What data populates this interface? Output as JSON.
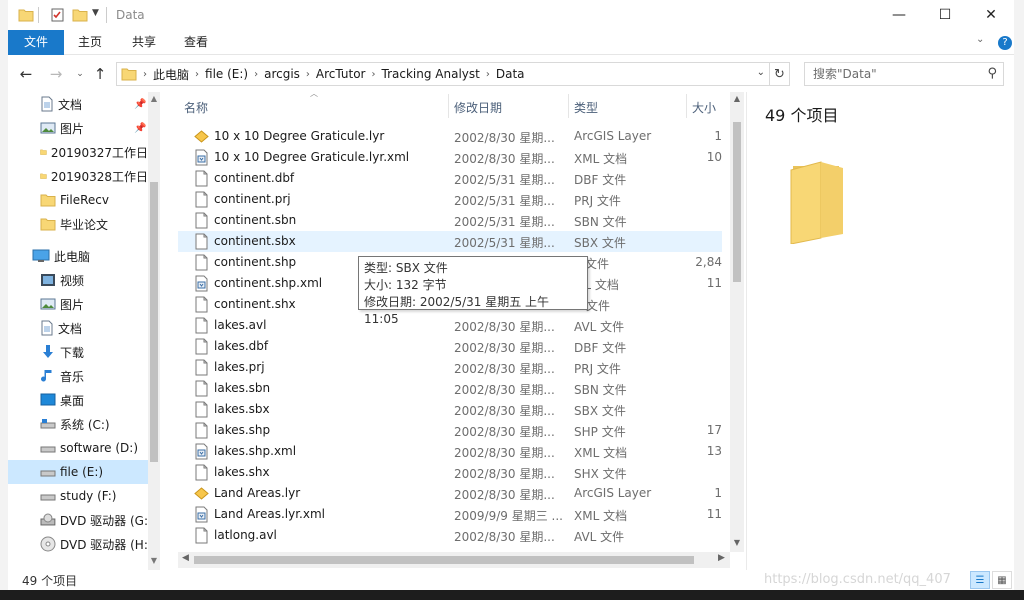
{
  "window": {
    "title": "Data"
  },
  "ribbon": {
    "tabs": [
      "文件",
      "主页",
      "共享",
      "查看"
    ]
  },
  "address": {
    "segments": [
      "此电脑",
      "file (E:)",
      "arcgis",
      "ArcTutor",
      "Tracking Analyst",
      "Data"
    ]
  },
  "search": {
    "placeholder": "搜索\"Data\""
  },
  "sidebar": {
    "items": [
      {
        "label": "文档",
        "icon": "document-icon",
        "pinned": true
      },
      {
        "label": "图片",
        "icon": "pictures-icon",
        "pinned": true
      },
      {
        "label": "20190327工作日",
        "icon": "folder-icon"
      },
      {
        "label": "20190328工作日",
        "icon": "folder-icon"
      },
      {
        "label": "FileRecv",
        "icon": "folder-icon"
      },
      {
        "label": "毕业论文",
        "icon": "folder-icon"
      },
      {
        "label": "此电脑",
        "icon": "computer-icon"
      },
      {
        "label": "视频",
        "icon": "video-icon"
      },
      {
        "label": "图片",
        "icon": "pictures-icon"
      },
      {
        "label": "文档",
        "icon": "document-icon"
      },
      {
        "label": "下载",
        "icon": "download-icon"
      },
      {
        "label": "音乐",
        "icon": "music-icon"
      },
      {
        "label": "桌面",
        "icon": "desktop-icon"
      },
      {
        "label": "系统 (C:)",
        "icon": "drive-icon"
      },
      {
        "label": "software (D:)",
        "icon": "drive-icon"
      },
      {
        "label": "file (E:)",
        "icon": "drive-icon",
        "selected": true
      },
      {
        "label": "study (F:)",
        "icon": "drive-icon"
      },
      {
        "label": "DVD 驱动器 (G:",
        "icon": "dvd-icon"
      },
      {
        "label": "DVD 驱动器 (H:",
        "icon": "dvd-icon"
      }
    ]
  },
  "columns": {
    "name": "名称",
    "date": "修改日期",
    "type": "类型",
    "size": "大小"
  },
  "files": [
    {
      "name": "10 x 10 Degree Graticule.lyr",
      "date": "2002/8/30 星期...",
      "type": "ArcGIS Layer",
      "size": "1",
      "icon": "layer-icon"
    },
    {
      "name": "10 x 10 Degree Graticule.lyr.xml",
      "date": "2002/8/30 星期...",
      "type": "XML 文档",
      "size": "10",
      "icon": "xml-icon"
    },
    {
      "name": "continent.dbf",
      "date": "2002/5/31 星期...",
      "type": "DBF 文件",
      "size": "",
      "icon": "file-icon"
    },
    {
      "name": "continent.prj",
      "date": "2002/5/31 星期...",
      "type": "PRJ 文件",
      "size": "",
      "icon": "file-icon"
    },
    {
      "name": "continent.sbn",
      "date": "2002/5/31 星期...",
      "type": "SBN 文件",
      "size": "",
      "icon": "file-icon"
    },
    {
      "name": "continent.sbx",
      "date": "2002/5/31 星期...",
      "type": "SBX 文件",
      "size": "",
      "icon": "file-icon",
      "selected": true
    },
    {
      "name": "continent.shp",
      "date": "",
      "type": "P 文件",
      "size": "2,84",
      "icon": "file-icon"
    },
    {
      "name": "continent.shp.xml",
      "date": "",
      "type": "ML 文档",
      "size": "11",
      "icon": "xml-icon"
    },
    {
      "name": "continent.shx",
      "date": "",
      "type": "X 文件",
      "size": "",
      "icon": "file-icon"
    },
    {
      "name": "lakes.avl",
      "date": "2002/8/30 星期...",
      "type": "AVL 文件",
      "size": "",
      "icon": "file-icon"
    },
    {
      "name": "lakes.dbf",
      "date": "2002/8/30 星期...",
      "type": "DBF 文件",
      "size": "",
      "icon": "file-icon"
    },
    {
      "name": "lakes.prj",
      "date": "2002/8/30 星期...",
      "type": "PRJ 文件",
      "size": "",
      "icon": "file-icon"
    },
    {
      "name": "lakes.sbn",
      "date": "2002/8/30 星期...",
      "type": "SBN 文件",
      "size": "",
      "icon": "file-icon"
    },
    {
      "name": "lakes.sbx",
      "date": "2002/8/30 星期...",
      "type": "SBX 文件",
      "size": "",
      "icon": "file-icon"
    },
    {
      "name": "lakes.shp",
      "date": "2002/8/30 星期...",
      "type": "SHP 文件",
      "size": "17",
      "icon": "file-icon"
    },
    {
      "name": "lakes.shp.xml",
      "date": "2002/8/30 星期...",
      "type": "XML 文档",
      "size": "13",
      "icon": "xml-icon"
    },
    {
      "name": "lakes.shx",
      "date": "2002/8/30 星期...",
      "type": "SHX 文件",
      "size": "",
      "icon": "file-icon"
    },
    {
      "name": "Land Areas.lyr",
      "date": "2002/8/30 星期...",
      "type": "ArcGIS Layer",
      "size": "1",
      "icon": "layer-icon"
    },
    {
      "name": "Land Areas.lyr.xml",
      "date": "2009/9/9 星期三 ...",
      "type": "XML 文档",
      "size": "11",
      "icon": "xml-icon"
    },
    {
      "name": "latlong.avl",
      "date": "2002/8/30 星期...",
      "type": "AVL 文件",
      "size": "",
      "icon": "file-icon"
    }
  ],
  "tooltip": {
    "line1": "类型: SBX 文件",
    "line2": "大小: 132 字节",
    "line3": "修改日期: 2002/5/31 星期五 上午 11:05"
  },
  "preview": {
    "count": "49 个项目"
  },
  "status": {
    "count": "49 个项目"
  },
  "watermark": "https://blog.csdn.net/qq_407",
  "colors": {
    "accent": "#1979ca",
    "selected": "#cce8ff",
    "folder": "#f8d775"
  }
}
